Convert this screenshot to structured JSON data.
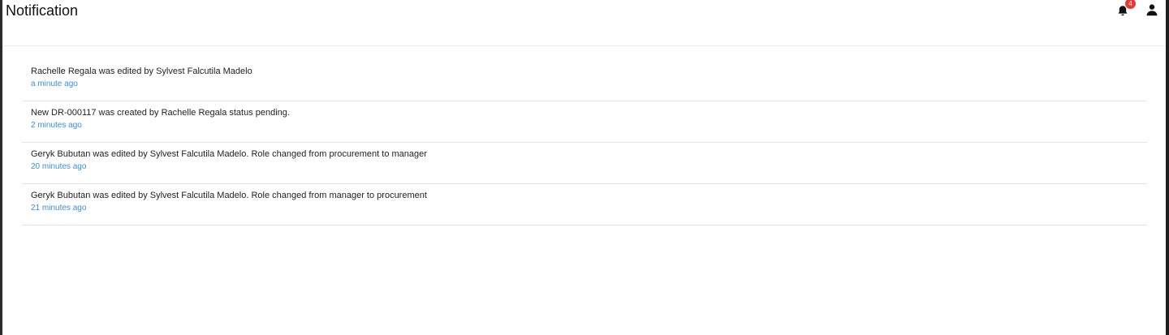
{
  "header": {
    "title": "Notification",
    "bell_icon": "bell-icon",
    "badge_count": "4",
    "user_icon": "user-icon"
  },
  "colors": {
    "accent_time": "#3a8ee6",
    "badge": "#e53935"
  },
  "notifications": [
    {
      "message": "Rachelle Regala was edited by Sylvest Falcutila Madelo",
      "time": "a minute ago"
    },
    {
      "message": "New DR-000117 was created by Rachelle Regala status pending.",
      "time": "2 minutes ago"
    },
    {
      "message": "Geryk Bubutan was edited by Sylvest Falcutila Madelo. Role changed from procurement to manager",
      "time": "20 minutes ago"
    },
    {
      "message": "Geryk Bubutan was edited by Sylvest Falcutila Madelo. Role changed from manager to procurement",
      "time": "21 minutes ago"
    }
  ]
}
